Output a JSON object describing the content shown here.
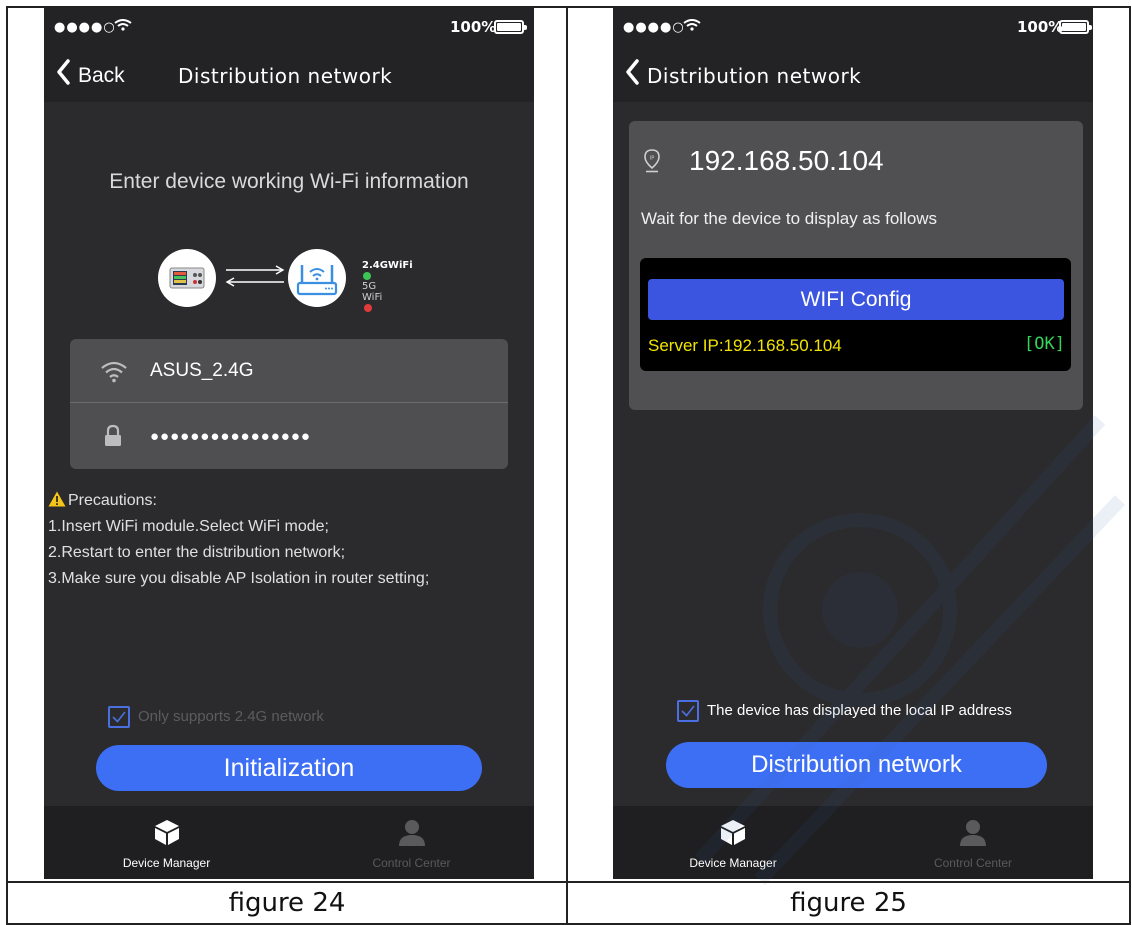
{
  "figure_left": {
    "caption": "figure 24",
    "status": {
      "signal": "●●●●○",
      "battery": "100%"
    },
    "nav": {
      "back_label": "Back",
      "title": "Distribution network"
    },
    "heading": "Enter device working Wi-Fi information",
    "diagram": {
      "legend_24": "2.4GWiFi",
      "legend_5": "5G  WiFi"
    },
    "form": {
      "ssid": "ASUS_2.4G",
      "password": "●●●●●●●●●●●●●●●●"
    },
    "precautions": {
      "title": "Precautions:",
      "lines": [
        "1.Insert WiFi module.Select WiFi mode;",
        "2.Restart to enter the distribution network;",
        "3.Make sure you disable AP Isolation in router setting;"
      ]
    },
    "checkbox_label": "Only supports 2.4G network",
    "button": "Initialization",
    "tabs": {
      "device_manager": "Device Manager",
      "control_center": "Control Center"
    }
  },
  "figure_right": {
    "caption": "figure 25",
    "status": {
      "signal": "●●●●○",
      "battery": "100%"
    },
    "nav": {
      "title": "Distribution network"
    },
    "ip": "192.168.50.104",
    "wait_text": "Wait for the device to display as follows",
    "device_screen": {
      "title": "WIFI Config",
      "server_ip": "Server IP:192.168.50.104",
      "status": "[OK]"
    },
    "checkbox_label": "The device has displayed the local IP address",
    "button": "Distribution network",
    "tabs": {
      "device_manager": "Device Manager",
      "control_center": "Control Center"
    }
  },
  "colors": {
    "background": "#2b2b2d",
    "accent_blue": "#3d6ff5",
    "ok_green": "#35d35a",
    "server_yellow": "#f2e400"
  }
}
